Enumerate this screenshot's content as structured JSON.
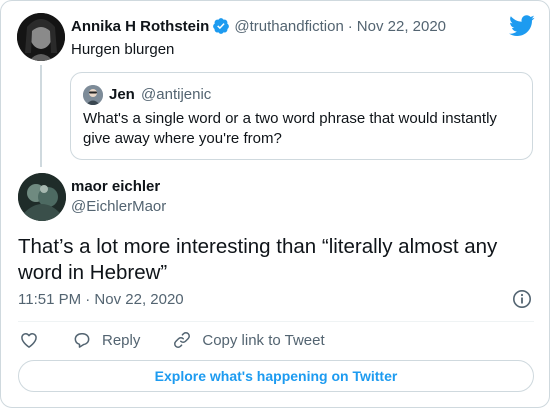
{
  "parent_tweet": {
    "author_name": "Annika H Rothstein",
    "handle": "@truthandfiction",
    "separator": "·",
    "date": "Nov 22, 2020",
    "text": "Hurgen blurgen"
  },
  "quoted_tweet": {
    "author_name": "Jen",
    "handle": "@antijenic",
    "text": "What's a single word or a two word phrase that would instantly give away where you're from?"
  },
  "reply_tweet": {
    "author_name": "maor eichler",
    "handle": "@EichlerMaor",
    "text": "That’s a lot more interesting than “literally almost any word in Hebrew”",
    "timestamp": "11:51 PM · Nov 22, 2020"
  },
  "actions": {
    "reply_label": "Reply",
    "copy_link_label": "Copy link to Tweet"
  },
  "explore_label": "Explore what's happening on Twitter",
  "colors": {
    "accent": "#1d9bf0",
    "secondary_text": "#536471",
    "border": "#cfd9de"
  },
  "icons": {
    "logo": "twitter-bird-icon",
    "verified": "verified-badge-icon",
    "info": "info-icon",
    "like": "heart-icon",
    "reply": "reply-bubble-icon",
    "copy_link": "link-icon"
  }
}
